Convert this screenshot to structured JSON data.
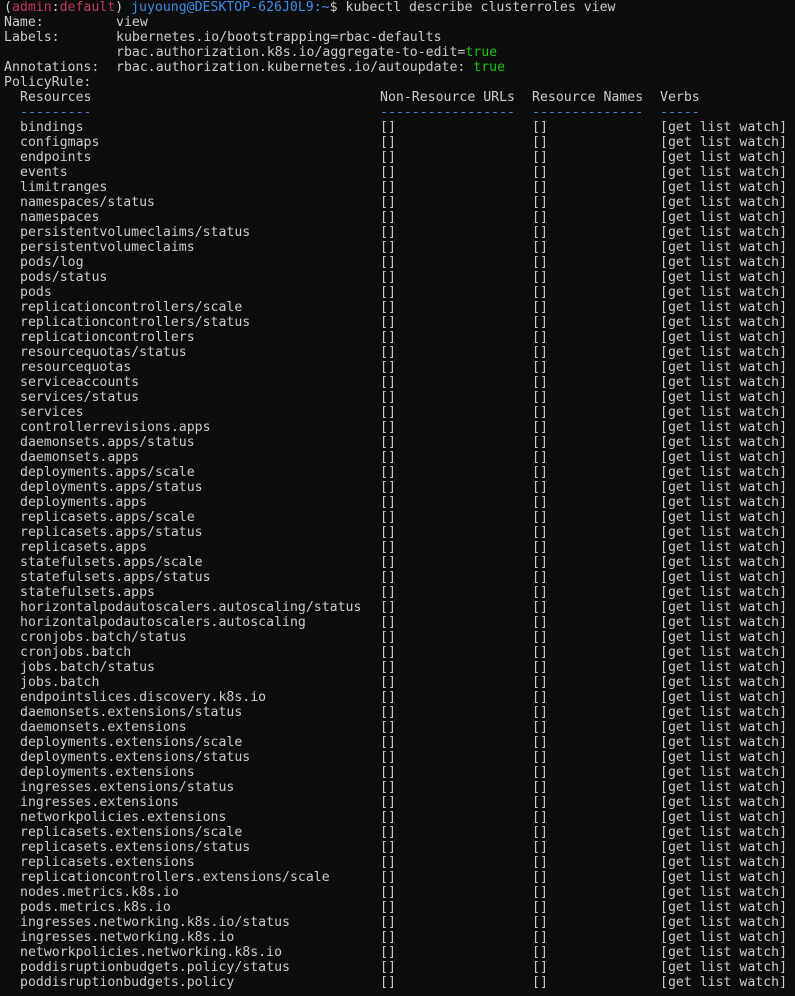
{
  "prompt": {
    "open_paren": "(",
    "ctx_user": "admin",
    "colon": ":",
    "ctx_ns": "default",
    "close_paren": ")",
    "user_host": "juyoung@DESKTOP-626J0L9",
    "path_sep": ":",
    "path": "~",
    "symbol": "$",
    "command": "kubectl describe clusterroles view"
  },
  "meta": {
    "name_key": "Name:",
    "name_val": "view",
    "labels_key": "Labels:",
    "label1": "kubernetes.io/bootstrapping=rbac-defaults",
    "label2_key": "rbac.authorization.k8s.io/aggregate-to-edit=",
    "label2_val": "true",
    "annotations_key": "Annotations:",
    "annotation_key": "rbac.authorization.kubernetes.io/autoupdate: ",
    "annotation_val": "true",
    "policy_key": "PolicyRule:"
  },
  "table": {
    "headers": [
      "Resources",
      "Non-Resource URLs",
      "Resource Names",
      "Verbs"
    ],
    "separators": [
      "---------",
      "-----------------",
      "--------------",
      "-----"
    ],
    "empty": "[]",
    "verbs": "[get list watch]",
    "rows": [
      "bindings",
      "configmaps",
      "endpoints",
      "events",
      "limitranges",
      "namespaces/status",
      "namespaces",
      "persistentvolumeclaims/status",
      "persistentvolumeclaims",
      "pods/log",
      "pods/status",
      "pods",
      "replicationcontrollers/scale",
      "replicationcontrollers/status",
      "replicationcontrollers",
      "resourcequotas/status",
      "resourcequotas",
      "serviceaccounts",
      "services/status",
      "services",
      "controllerrevisions.apps",
      "daemonsets.apps/status",
      "daemonsets.apps",
      "deployments.apps/scale",
      "deployments.apps/status",
      "deployments.apps",
      "replicasets.apps/scale",
      "replicasets.apps/status",
      "replicasets.apps",
      "statefulsets.apps/scale",
      "statefulsets.apps/status",
      "statefulsets.apps",
      "horizontalpodautoscalers.autoscaling/status",
      "horizontalpodautoscalers.autoscaling",
      "cronjobs.batch/status",
      "cronjobs.batch",
      "jobs.batch/status",
      "jobs.batch",
      "endpointslices.discovery.k8s.io",
      "daemonsets.extensions/status",
      "daemonsets.extensions",
      "deployments.extensions/scale",
      "deployments.extensions/status",
      "deployments.extensions",
      "ingresses.extensions/status",
      "ingresses.extensions",
      "networkpolicies.extensions",
      "replicasets.extensions/scale",
      "replicasets.extensions/status",
      "replicasets.extensions",
      "replicationcontrollers.extensions/scale",
      "nodes.metrics.k8s.io",
      "pods.metrics.k8s.io",
      "ingresses.networking.k8s.io/status",
      "ingresses.networking.k8s.io",
      "networkpolicies.networking.k8s.io",
      "poddisruptionbudgets.policy/status",
      "poddisruptionbudgets.policy"
    ]
  },
  "colors": {
    "background": "#0c0c0c",
    "text": "#cccccc",
    "context": "#c2395a",
    "prompt": "#3b8eea",
    "bool": "#16c60c"
  }
}
